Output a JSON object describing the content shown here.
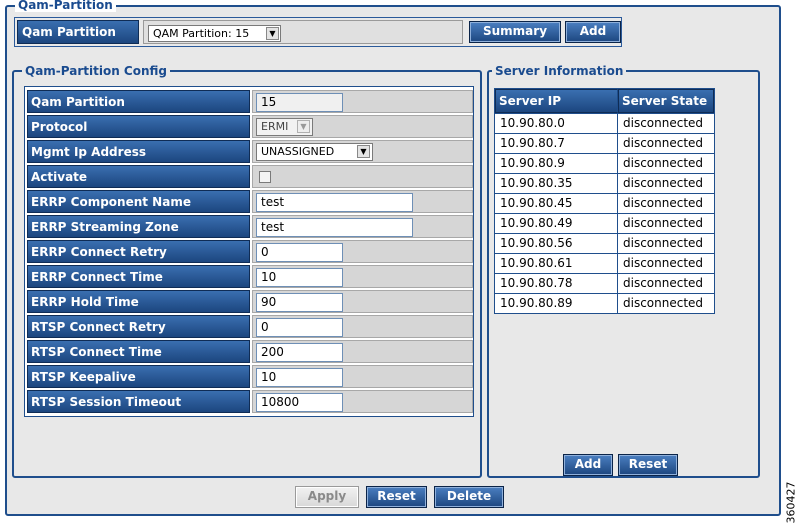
{
  "qam_partition_section": {
    "legend": "Qam-Partition",
    "label": "Qam Partition",
    "selected_partition": "QAM Partition: 15",
    "summary_button": "Summary",
    "add_button": "Add"
  },
  "config": {
    "legend": "Qam-Partition Config",
    "rows": [
      {
        "label": "Qam Partition",
        "value": "15"
      },
      {
        "label": "Protocol",
        "value": "ERMI"
      },
      {
        "label": "Mgmt Ip Address",
        "value": "UNASSIGNED"
      },
      {
        "label": "Activate",
        "checked": false
      },
      {
        "label": "ERRP Component Name",
        "value": "test"
      },
      {
        "label": "ERRP Streaming Zone",
        "value": "test"
      },
      {
        "label": "ERRP Connect Retry",
        "value": "0"
      },
      {
        "label": "ERRP Connect Time",
        "value": "10"
      },
      {
        "label": "ERRP Hold Time",
        "value": "90"
      },
      {
        "label": "RTSP Connect Retry",
        "value": "0"
      },
      {
        "label": "RTSP Connect Time",
        "value": "200"
      },
      {
        "label": "RTSP Keepalive",
        "value": "10"
      },
      {
        "label": "RTSP Session Timeout",
        "value": "10800"
      }
    ]
  },
  "server_info": {
    "legend": "Server Information",
    "columns": [
      "Server IP Address",
      "Server State"
    ],
    "rows": [
      {
        "ip": "10.90.80.0",
        "state": "disconnected"
      },
      {
        "ip": "10.90.80.7",
        "state": "disconnected"
      },
      {
        "ip": "10.90.80.9",
        "state": "disconnected"
      },
      {
        "ip": "10.90.80.35",
        "state": "disconnected"
      },
      {
        "ip": "10.90.80.45",
        "state": "disconnected"
      },
      {
        "ip": "10.90.80.49",
        "state": "disconnected"
      },
      {
        "ip": "10.90.80.56",
        "state": "disconnected"
      },
      {
        "ip": "10.90.80.61",
        "state": "disconnected"
      },
      {
        "ip": "10.90.80.78",
        "state": "disconnected"
      },
      {
        "ip": "10.90.80.89",
        "state": "disconnected"
      }
    ],
    "add_button": "Add",
    "reset_button": "Reset"
  },
  "footer": {
    "apply_button": "Apply",
    "reset_button": "Reset",
    "delete_button": "Delete"
  },
  "figure_id": "360427",
  "icons": {
    "dropdown": "chevron-down-icon"
  },
  "colors": {
    "header_blue": "#1f4e8c",
    "panel_gray": "#e8e8e8"
  }
}
